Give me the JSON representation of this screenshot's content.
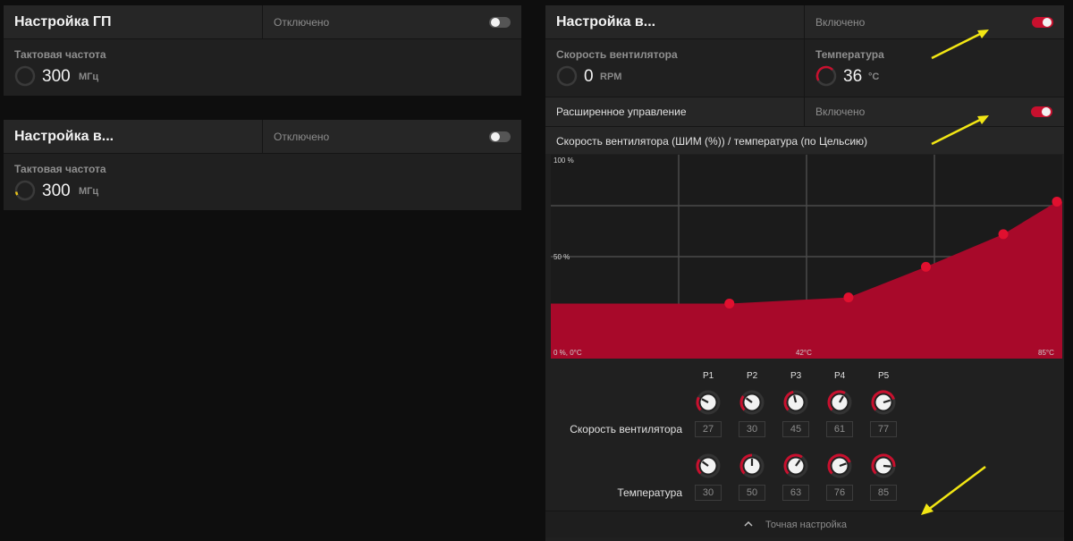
{
  "gpu_tuning": {
    "title": "Настройка ГП",
    "status": "Отключено",
    "enabled": false,
    "clock_label": "Тактовая частота",
    "clock_value": "300",
    "clock_unit": "МГц"
  },
  "vram_tuning": {
    "title": "Настройка в...",
    "status": "Отключено",
    "enabled": false,
    "clock_label": "Тактовая частота",
    "clock_value": "300",
    "clock_unit": "МГц"
  },
  "fan_tuning": {
    "title": "Настройка в...",
    "status": "Включено",
    "enabled": true,
    "fan_speed_label": "Скорость вентилятора",
    "fan_speed_value": "0",
    "fan_speed_unit": "RPM",
    "temp_label": "Температура",
    "temp_value": "36",
    "temp_unit": "°C",
    "advanced_label": "Расширенное управление",
    "advanced_status": "Включено",
    "advanced_enabled": true,
    "curve_title": "Скорость вентилятора (ШИМ (%)) / температура (по Цельсию)"
  },
  "chart_data": {
    "type": "area",
    "title": "Скорость вентилятора (ШИМ (%)) / температура (по Цельсию)",
    "y_ticks": [
      "100 %",
      "50 %"
    ],
    "x_ticks": [
      "0 %, 0°C",
      "42°C",
      "85°C"
    ],
    "xlim": [
      0,
      85
    ],
    "ylim": [
      0,
      100
    ],
    "x": [
      30,
      50,
      63,
      76,
      85
    ],
    "y": [
      27,
      30,
      45,
      61,
      77
    ],
    "start_level": 27,
    "fill_color": "#a8092a",
    "point_color": "#e0102f"
  },
  "points": {
    "labels": [
      "P1",
      "P2",
      "P3",
      "P4",
      "P5"
    ],
    "fan_row_label": "Скорость вентилятора",
    "temp_row_label": "Температура",
    "fan_values": [
      "27",
      "30",
      "45",
      "61",
      "77"
    ],
    "temp_values": [
      "30",
      "50",
      "63",
      "76",
      "85"
    ]
  },
  "footer": {
    "label": "Точная настройка"
  },
  "colors": {
    "accent": "#c8102e",
    "annotation_arrow": "#f2e614"
  }
}
